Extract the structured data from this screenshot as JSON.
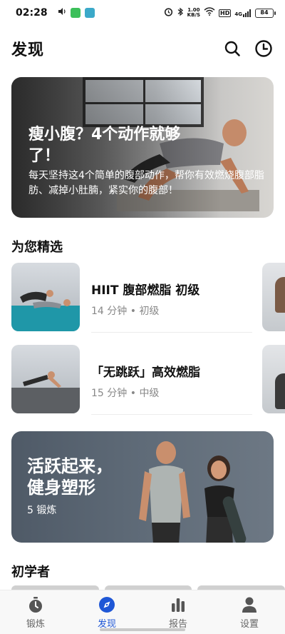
{
  "status_bar": {
    "time": "02:28",
    "network_speed_value": "1.00",
    "network_speed_unit": "KB/S",
    "hd_label": "HD",
    "signal_label": "4G",
    "battery": "84"
  },
  "header": {
    "title": "发现",
    "search_icon": "search-icon",
    "history_icon": "clock-icon"
  },
  "hero": {
    "title": "瘦小腹？4个动作就够了！",
    "description": "每天坚持这4个简单的腹部动作，帮你有效燃烧腹部脂肪、减掉小肚腩，紧实你的腹部！"
  },
  "picks": {
    "title": "为您精选",
    "items": [
      {
        "title": "HIIT 腹部燃脂 初级",
        "duration": "14 分钟",
        "level": "初级"
      },
      {
        "title": "「无跳跃」高效燃脂",
        "duration": "15 分钟",
        "level": "中级"
      }
    ]
  },
  "promo": {
    "title_line1": "活跃起来，",
    "title_line2": "健身塑形",
    "count": "5 锻炼"
  },
  "beginner": {
    "title": "初学者"
  },
  "nav": {
    "items": [
      {
        "label": "锻炼",
        "icon": "stopwatch-icon"
      },
      {
        "label": "发现",
        "icon": "compass-icon"
      },
      {
        "label": "报告",
        "icon": "bar-chart-icon"
      },
      {
        "label": "设置",
        "icon": "person-icon"
      }
    ],
    "active_color": "#1f57d6"
  }
}
